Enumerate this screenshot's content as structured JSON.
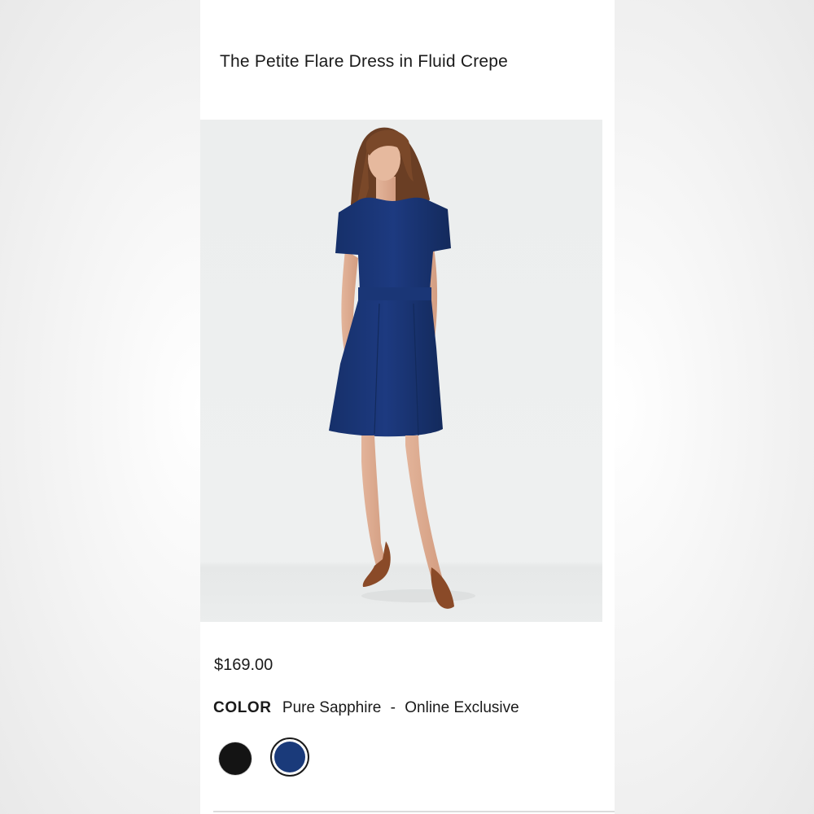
{
  "product": {
    "title": "The Petite Flare Dress in Fluid Crepe",
    "price": "$169.00"
  },
  "color": {
    "label": "COLOR",
    "selected_name": "Pure Sapphire",
    "separator": "-",
    "availability": "Online Exclusive",
    "swatches": [
      {
        "name": "black",
        "hex": "#141414",
        "selected": false
      },
      {
        "name": "Pure Sapphire",
        "hex": "#1a3a7a",
        "selected": true
      }
    ]
  },
  "image": {
    "subject": "model-wearing-navy-dress"
  }
}
